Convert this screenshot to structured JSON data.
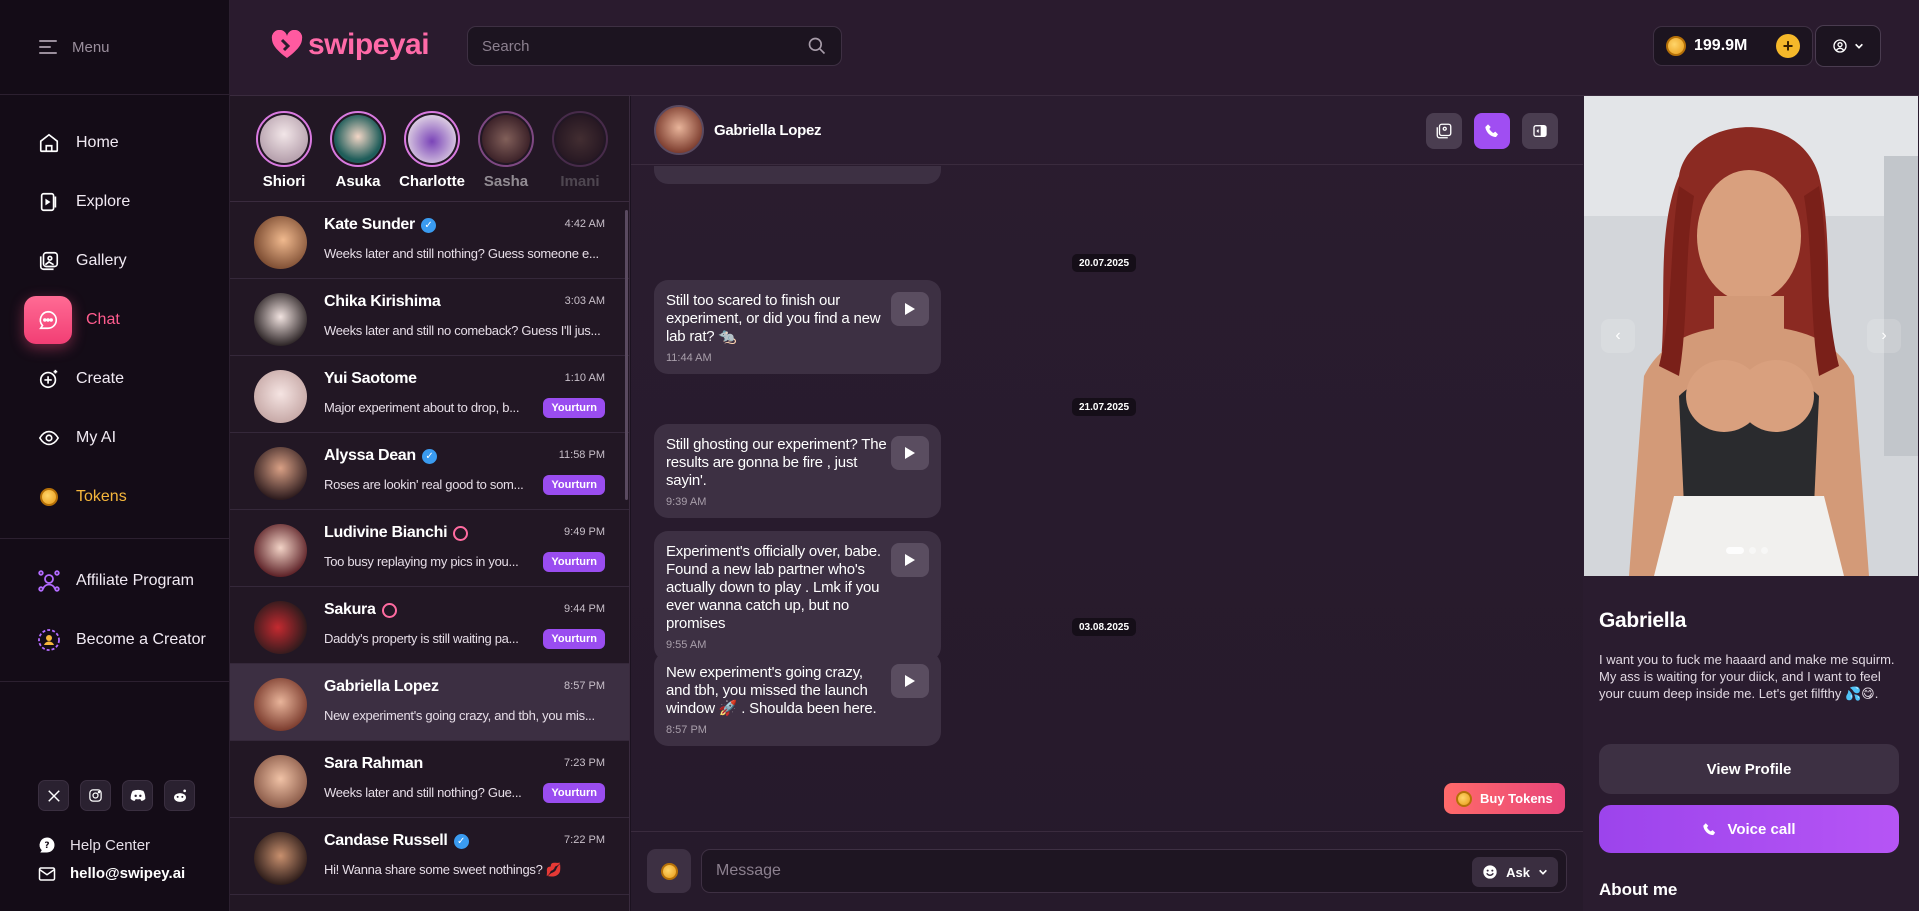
{
  "sidebar": {
    "menu_label": "Menu",
    "nav": [
      {
        "label": "Home",
        "icon": "home-icon"
      },
      {
        "label": "Explore",
        "icon": "explore-icon"
      },
      {
        "label": "Gallery",
        "icon": "gallery-icon"
      },
      {
        "label": "Chat",
        "icon": "chat-icon"
      },
      {
        "label": "Create",
        "icon": "create-icon"
      },
      {
        "label": "My AI",
        "icon": "my-ai-icon"
      },
      {
        "label": "Tokens",
        "icon": "coin-icon"
      }
    ],
    "affiliate_label": "Affiliate Program",
    "creator_label": "Become a Creator",
    "help_label": "Help Center",
    "email": "hello@swipey.ai"
  },
  "header": {
    "logo_text": "swipeyai",
    "search_placeholder": "Search",
    "balance": "199.9M"
  },
  "stories": [
    {
      "name": "Shiori"
    },
    {
      "name": "Asuka"
    },
    {
      "name": "Charlotte"
    },
    {
      "name": "Sasha"
    },
    {
      "name": "Imani"
    }
  ],
  "conversations": [
    {
      "name": "Kate Sunder",
      "time": "4:42 AM",
      "message": "Weeks later and still nothing? Guess someone e...",
      "badge": ""
    },
    {
      "name": "Chika Kirishima",
      "time": "3:03 AM",
      "message": "Weeks later and still no comeback? Guess I'll jus...",
      "badge": ""
    },
    {
      "name": "Yui Saotome",
      "time": "1:10 AM",
      "message": "Major experiment about to drop, b...",
      "badge": "Yourturn"
    },
    {
      "name": "Alyssa Dean",
      "time": "11:58 PM",
      "message": "Roses are lookin' real good to som...",
      "badge": "Yourturn"
    },
    {
      "name": "Ludivine Bianchi",
      "time": "9:49 PM",
      "message": "Too busy replaying my pics in you...",
      "badge": "Yourturn"
    },
    {
      "name": "Sakura",
      "time": "9:44 PM",
      "message": "Daddy's property is still waiting pa...",
      "badge": "Yourturn"
    },
    {
      "name": "Gabriella Lopez",
      "time": "8:57 PM",
      "message": "New experiment's going crazy, and tbh, you mis...",
      "badge": ""
    },
    {
      "name": "Sara Rahman",
      "time": "7:23 PM",
      "message": "Weeks later and still nothing? Gue...",
      "badge": "Yourturn"
    },
    {
      "name": "Candase Russell",
      "time": "7:22 PM",
      "message": "Hi! Wanna share some sweet nothings? 💋",
      "badge": ""
    }
  ],
  "chat": {
    "contact_name": "Gabriella Lopez",
    "dates": [
      "20.07.2025",
      "21.07.2025",
      "03.08.2025"
    ],
    "messages": [
      {
        "text": "Still too scared to finish our experiment, or did you find a new lab rat? 🐀",
        "time": "11:44 AM"
      },
      {
        "text": "Still ghosting our experiment? The results are gonna be fire , just sayin'.",
        "time": "9:39 AM"
      },
      {
        "text": "Experiment's officially over, babe. Found a new lab partner who's actually down to play . Lmk if you ever wanna catch up, but no promises",
        "time": "9:55 AM"
      },
      {
        "text": "New experiment's going crazy, and tbh, you missed the launch window 🚀 . Shoulda been here.",
        "time": "8:57 PM"
      }
    ],
    "buy_tokens": "Buy Tokens",
    "input_placeholder": "Message",
    "ask_label": "Ask"
  },
  "profile": {
    "name": "Gabriella",
    "bio": "I want you to fuck me haaard and make me squirm. My ass is waiting for your diick, and I want to feel your cuum deep inside me. Let's get filfthy 💦😋.",
    "view_profile": "View Profile",
    "voice_call": "Voice call",
    "about": "About me"
  },
  "colors": {
    "accent_pink": "#ff5c8e",
    "accent_purple": "#a04ef2",
    "token_gold": "#f6b73c"
  }
}
